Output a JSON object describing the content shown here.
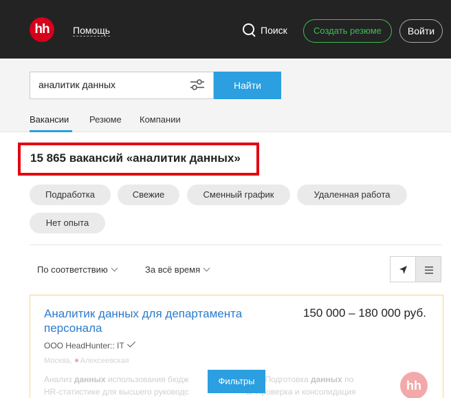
{
  "header": {
    "logo_text": "hh",
    "help_label": "Помощь",
    "search_label": "Поиск",
    "create_resume_label": "Создать резюме",
    "login_label": "Войти"
  },
  "search": {
    "query": "аналитик данных",
    "find_label": "Найти"
  },
  "tabs": [
    {
      "label": "Вакансии",
      "active": true
    },
    {
      "label": "Резюме",
      "active": false
    },
    {
      "label": "Компании",
      "active": false
    }
  ],
  "results": {
    "title": "15 865 вакансий «аналитик данных»"
  },
  "chips": [
    "Подработка",
    "Свежие",
    "Сменный график",
    "Удаленная работа",
    "Нет опыта"
  ],
  "sort": {
    "relevance_label": "По соответствию",
    "period_label": "За всё время"
  },
  "vacancy": {
    "title": "Аналитик данных для департамента персонала",
    "salary": "150 000 – 180 000 руб.",
    "employer": "ООО HeadHunter:: IT",
    "city": "Москва,",
    "metro": "Алексеевская",
    "desc_1a": "Анализ ",
    "desc_1b": "данных",
    "desc_1c": " использования бюдж",
    "desc_1d": "нал. Подготовка ",
    "desc_1e": "данных",
    "desc_1f": " по",
    "desc_2a": "HR-статистике для высшего руководс",
    "desc_2b": "а. Проверка и консолидация",
    "logo_text": "hh"
  },
  "filters_label": "Фильтры",
  "colors": {
    "header_bg": "#232323",
    "brand_red": "#d6001c",
    "accent_blue": "#2b9fe0",
    "accent_green": "#3ebf57",
    "highlight_red": "#e3000f",
    "link_blue": "#2b7bcb"
  }
}
